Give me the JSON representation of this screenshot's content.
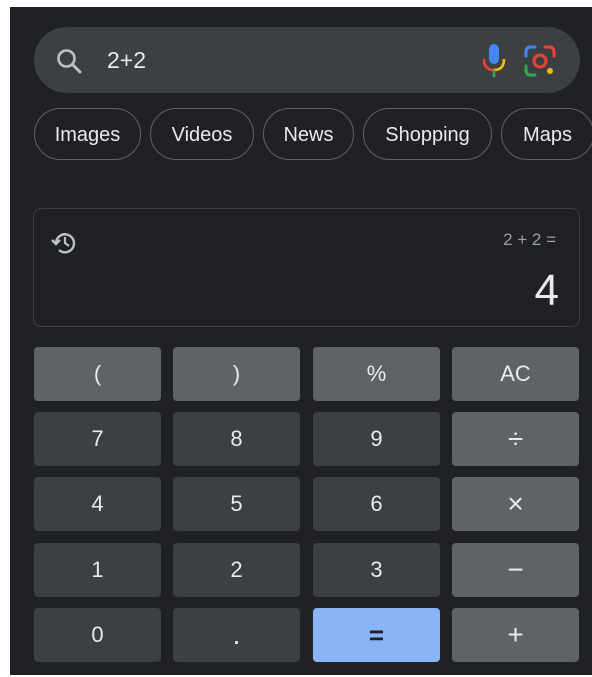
{
  "colors": {
    "background": "#202124",
    "search_bg": "#3c4043",
    "func_key": "#5f6368",
    "num_key": "#3c4043",
    "equals_key": "#8ab4f8",
    "text": "#e8eaed",
    "muted_text": "#9aa0a6"
  },
  "search": {
    "query": "2+2",
    "icons": [
      "search-icon",
      "mic-icon",
      "lens-icon"
    ]
  },
  "chips": [
    {
      "label": "Images"
    },
    {
      "label": "Videos"
    },
    {
      "label": "News"
    },
    {
      "label": "Shopping"
    },
    {
      "label": "Maps"
    }
  ],
  "display": {
    "history_icon": "history-icon",
    "expression": "2 + 2 =",
    "result": "4"
  },
  "keypad": {
    "open_paren": "(",
    "close_paren": ")",
    "percent": "%",
    "clear": "AC",
    "seven": "7",
    "eight": "8",
    "nine": "9",
    "divide": "÷",
    "four": "4",
    "five": "5",
    "six": "6",
    "multiply": "×",
    "one": "1",
    "two": "2",
    "three": "3",
    "minus": "−",
    "zero": "0",
    "decimal": ".",
    "equals": "=",
    "plus": "+"
  }
}
